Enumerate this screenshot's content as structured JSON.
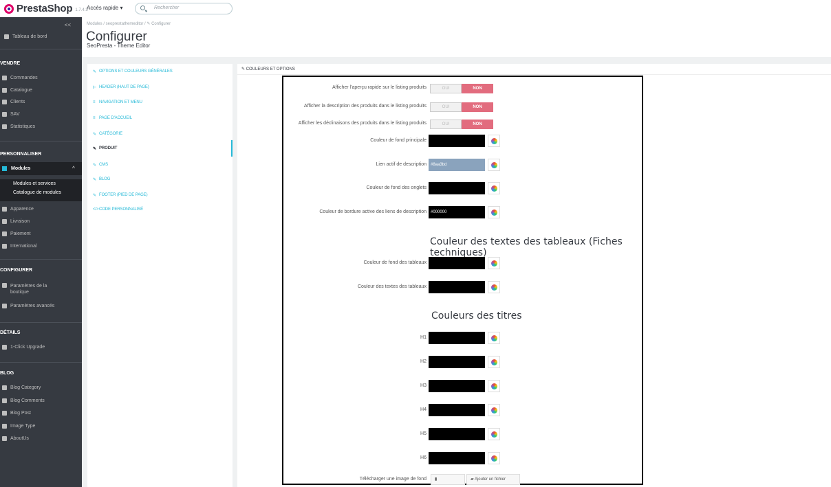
{
  "header": {
    "logo": "PrestaShop",
    "version": "1.7.4.3",
    "quick_access": "Accès rapide ▾",
    "search_placeholder": "Rechercher"
  },
  "sidebar": {
    "collapse": "<<",
    "dashboard": "Tableau de bord",
    "sections": {
      "sell": "VENDRE",
      "customize": "PERSONNALISER",
      "configure": "CONFIGURER",
      "details": "DÉTAILS",
      "blog": "BLOG"
    },
    "sell_items": [
      "Commandes",
      "Catalogue",
      "Clients",
      "SAV",
      "Statistiques"
    ],
    "modules": "Modules",
    "modules_sub": [
      "Modules et services",
      "Catalogue de modules"
    ],
    "customize_items": [
      "Apparence",
      "Livraison",
      "Paiement",
      "International"
    ],
    "configure_items": [
      "Paramètres de la boutique",
      "Paramètres avancés"
    ],
    "details_items": [
      "1-Click Upgrade"
    ],
    "blog_items": [
      "Blog Category",
      "Blog Comments",
      "Blog Post",
      "Image Type",
      "AboutUs"
    ]
  },
  "page": {
    "breadcrumb": "Modules  /  seoprestathemeditor  /  ✎ Configurer",
    "title": "Configurer",
    "subtitle": "SeoPresta - Theme Editor"
  },
  "tabs": [
    "OPTIONS ET COULEURS GÉNÉRALES",
    "HEADER (HAUT DE PAGE)",
    "NAVIGATION ET MENU",
    "PAGE D'ACCUEIL",
    "CATÉGORIE",
    "PRODUIT",
    "CMS",
    "BLOG",
    "FOOTER (PIED DE PAGE)",
    "CODE PERSONNALISÉ"
  ],
  "panel": {
    "title": "COULEURS ET OPTIONS",
    "toggles": [
      {
        "label": "Afficher l'aperçu rapide sur le listing produits",
        "yes": "OUI",
        "no": "NON"
      },
      {
        "label": "Afficher la description des produits dans le listing produits",
        "yes": "OUI",
        "no": "NON"
      },
      {
        "label": "Afficher les déclinaisons des produits dans le listing produits",
        "yes": "OUI",
        "no": "NON"
      }
    ],
    "colors": [
      {
        "label": "Couleur de fond principale",
        "value": ""
      },
      {
        "label": "Lien actif de description",
        "value": "#8aa3bd"
      },
      {
        "label": "Couleur de fond des onglets",
        "value": ""
      },
      {
        "label": "Couleur de bordure active des liens de description",
        "value": "#000000"
      }
    ],
    "section_tables": "Couleur des textes des tableaux (Fiches techniques)",
    "table_colors": [
      {
        "label": "Couleur de fond des tableaux",
        "value": ""
      },
      {
        "label": "Couleur des textes des tableaux",
        "value": ""
      }
    ],
    "section_titles": "Couleurs des titres",
    "heading_colors": [
      "H1",
      "H2",
      "H3",
      "H4",
      "H5",
      "H6"
    ],
    "upload_label": "Télécharger une image de fond",
    "upload_button": "Ajouter un fichier"
  },
  "colors": {
    "accent": "#25b9d7",
    "toggle_no": "#e26c7e",
    "sidebar_bg": "#363a41"
  }
}
